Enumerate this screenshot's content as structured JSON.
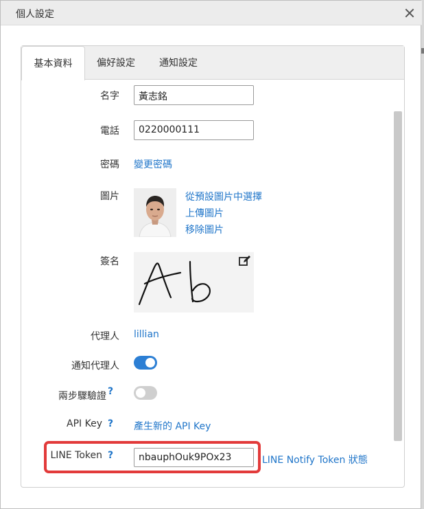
{
  "dialog": {
    "title": "個人設定"
  },
  "tabs": [
    {
      "label": "基本資料",
      "active": true
    },
    {
      "label": "偏好設定",
      "active": false
    },
    {
      "label": "通知設定",
      "active": false
    }
  ],
  "form": {
    "name": {
      "label": "名字",
      "value": "黃志銘"
    },
    "phone": {
      "label": "電話",
      "value": "0220000111"
    },
    "password": {
      "label": "密碼",
      "link": "變更密碼"
    },
    "picture": {
      "label": "圖片",
      "choose_default": "從預設圖片中選擇",
      "upload": "上傳圖片",
      "remove": "移除圖片"
    },
    "signature": {
      "label": "簽名"
    },
    "agent": {
      "label": "代理人",
      "value": "lillian"
    },
    "notify_agent": {
      "label": "通知代理人",
      "enabled": true
    },
    "two_step": {
      "label": "兩步驟驗證",
      "help": "?",
      "enabled": false
    },
    "api_key": {
      "label": "API Key",
      "help": "?",
      "link": "產生新的 API Key"
    },
    "line_token": {
      "label": "LINE Token",
      "help": "?",
      "value": "nbauphOuk9POx23",
      "status_link": "LINE Notify Token 狀態"
    }
  },
  "colors": {
    "accent": "#1f75c9",
    "toggle_on": "#2c7fd4",
    "highlight": "#e23a3a"
  }
}
